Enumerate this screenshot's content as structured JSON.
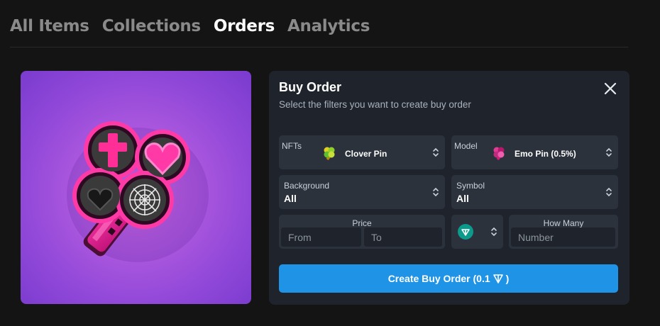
{
  "tabs": [
    {
      "label": "All Items",
      "active": false
    },
    {
      "label": "Collections",
      "active": false
    },
    {
      "label": "Orders",
      "active": true
    },
    {
      "label": "Analytics",
      "active": false
    }
  ],
  "preview": {
    "item": "Clover Pin",
    "background_color": "#9b4fdb"
  },
  "panel": {
    "title": "Buy Order",
    "subtitle": "Select the filters you want to create buy order",
    "nfts": {
      "label": "NFTs",
      "value": "Clover Pin",
      "icon": "clover-pin-thumbnail"
    },
    "model": {
      "label": "Model",
      "value": "Emo Pin (0.5%)",
      "icon": "emo-pin-thumbnail"
    },
    "background": {
      "label": "Background",
      "value": "All"
    },
    "symbol": {
      "label": "Symbol",
      "value": "All"
    },
    "price": {
      "label": "Price",
      "from_placeholder": "From",
      "to_placeholder": "To"
    },
    "currency": {
      "icon": "ton-icon",
      "color": "#0098ea"
    },
    "how_many": {
      "label": "How Many",
      "placeholder": "Number"
    },
    "create_button": {
      "label_prefix": "Create Buy Order (0.1",
      "label_suffix": ")",
      "icon": "ton-icon"
    }
  },
  "colors": {
    "accent": "#1f94e6",
    "panel": "#1f242c",
    "field": "#2b323c",
    "page": "#141414"
  }
}
